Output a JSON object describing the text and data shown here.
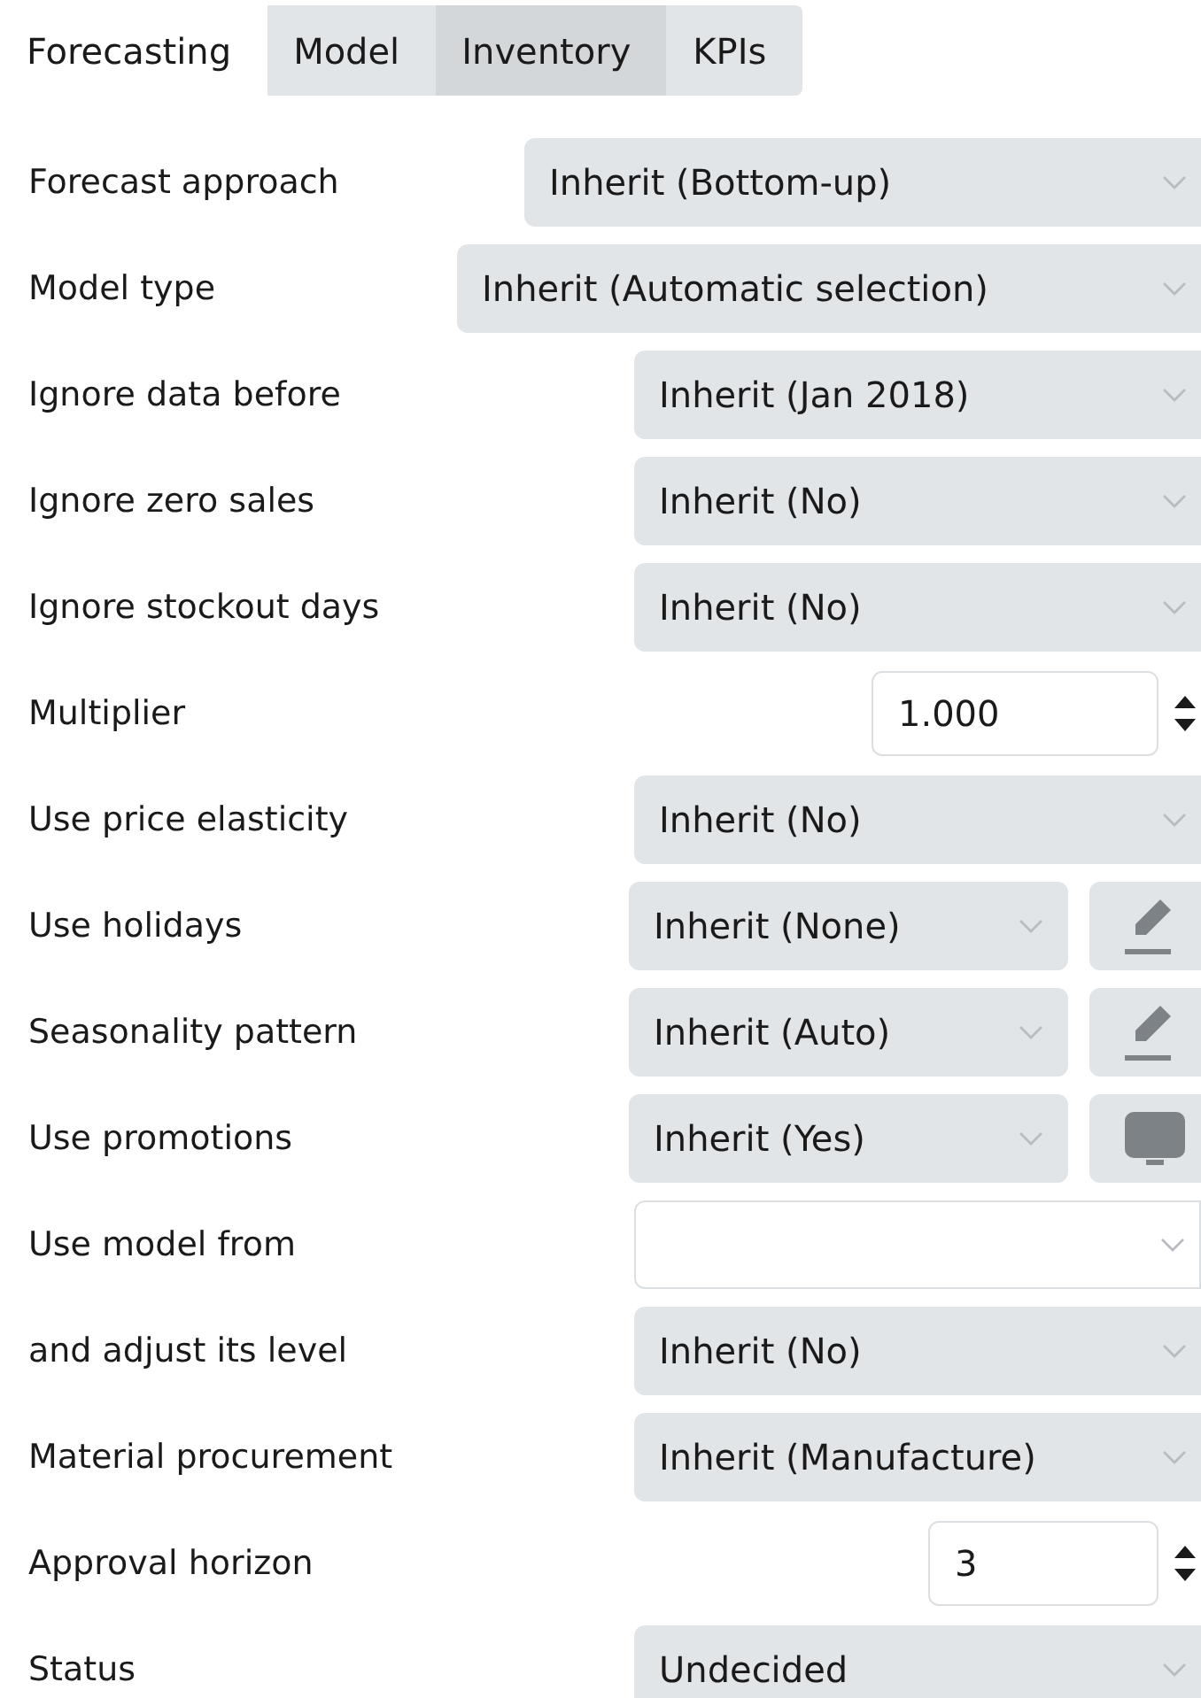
{
  "tabs": [
    {
      "label": "Forecasting",
      "selected": true,
      "hovered": false
    },
    {
      "label": "Model",
      "selected": false,
      "hovered": false
    },
    {
      "label": "Inventory",
      "selected": false,
      "hovered": true
    },
    {
      "label": "KPIs",
      "selected": false,
      "hovered": false
    }
  ],
  "fields": [
    {
      "label": "Forecast approach",
      "kind": "select",
      "value": "Inherit (Bottom-up)"
    },
    {
      "label": "Model type",
      "kind": "select",
      "value": "Inherit (Automatic selection)"
    },
    {
      "label": "Ignore data before",
      "kind": "select",
      "value": "Inherit (Jan 2018)"
    },
    {
      "label": "Ignore zero sales",
      "kind": "select",
      "value": "Inherit (No)"
    },
    {
      "label": "Ignore stockout days",
      "kind": "select",
      "value": "Inherit (No)"
    },
    {
      "label": "Multiplier",
      "kind": "number",
      "value": "1.000"
    },
    {
      "label": "Use price elasticity",
      "kind": "select",
      "value": "Inherit (No)"
    },
    {
      "label": "Use holidays",
      "kind": "select_button",
      "value": "Inherit (None)",
      "button": {
        "kind": "pencil"
      }
    },
    {
      "label": "Seasonality pattern",
      "kind": "select_button",
      "value": "Inherit (Auto)",
      "button": {
        "kind": "pencil"
      }
    },
    {
      "label": "Use promotions",
      "kind": "select_button",
      "value": "Inherit (Yes)",
      "button": {
        "kind": "monitor"
      }
    },
    {
      "label": "Use model from",
      "kind": "empty_select"
    },
    {
      "label": "and adjust its level",
      "kind": "select",
      "value": "Inherit (No)"
    },
    {
      "label": "Material procurement",
      "kind": "select",
      "value": "Inherit (Manufacture)"
    },
    {
      "label": "Approval horizon",
      "kind": "number",
      "value": "3"
    },
    {
      "label": "Status",
      "kind": "select",
      "value": "Undecided"
    }
  ]
}
